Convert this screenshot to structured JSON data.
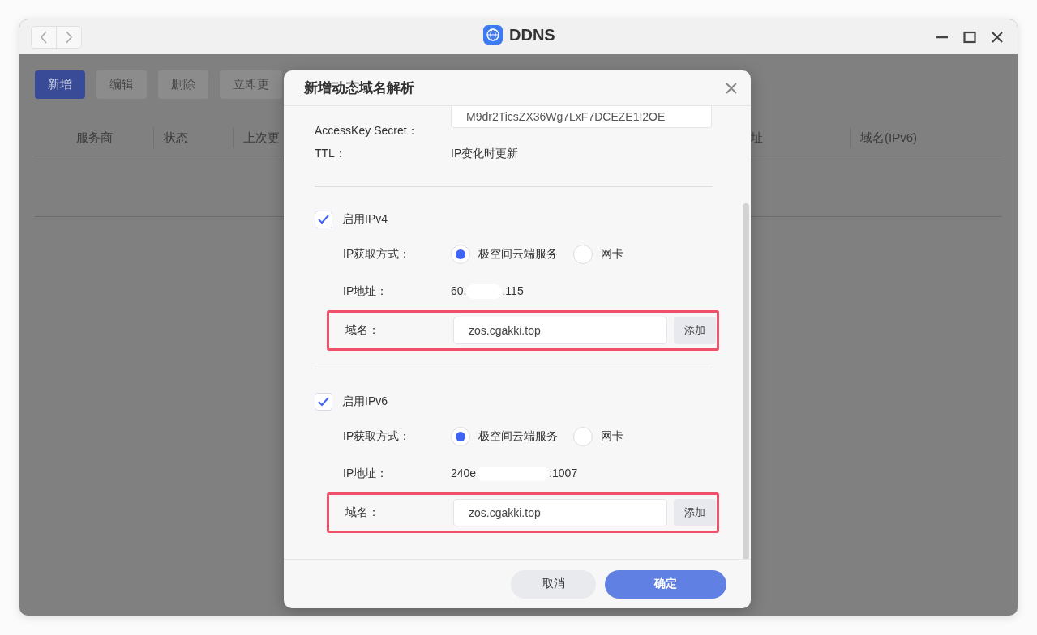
{
  "window": {
    "title": "DDNS"
  },
  "toolbar": [
    {
      "label": "新增",
      "disabled": false
    },
    {
      "label": "编辑",
      "disabled": true
    },
    {
      "label": "删除",
      "disabled": true
    },
    {
      "label": "立即更",
      "disabled": true
    }
  ],
  "table": {
    "columns": [
      "服务商",
      "状态",
      "上次更",
      "址",
      "域名(IPv6)"
    ]
  },
  "dialog": {
    "title": "新增动态域名解析",
    "fields": [
      {
        "label": "AccessKey Secret：",
        "kind": "input",
        "value": "M9dr2TicsZX36Wg7LxF7DCEZE1I2OE"
      },
      {
        "label": "TTL：",
        "kind": "text",
        "value": "IP变化时更新"
      }
    ],
    "sections": [
      {
        "label": "启用IPv4",
        "checked": true,
        "method_label": "IP获取方式：",
        "options": [
          {
            "label": "极空间云端服务",
            "selected": true
          },
          {
            "label": "网卡",
            "selected": false
          }
        ],
        "ip_label": "IP地址：",
        "ip_start": "60.",
        "ip_end": ".115",
        "domain_label": "域名：",
        "domain_value": "zos.cgakki.top",
        "add_button": "添加",
        "highlighted": true
      },
      {
        "label": "启用IPv6",
        "checked": true,
        "method_label": "IP获取方式：",
        "options": [
          {
            "label": "极空间云端服务",
            "selected": true
          },
          {
            "label": "网卡",
            "selected": false
          }
        ],
        "ip_label": "IP地址：",
        "ip_start": "240e",
        "ip_end": ":1007",
        "domain_label": "域名：",
        "domain_value": "zos.cgakki.top",
        "add_button": "添加",
        "highlighted": true
      }
    ],
    "buttons": [
      {
        "label": "取消",
        "kind": "secondary"
      },
      {
        "label": "确定",
        "kind": "primary"
      }
    ]
  }
}
